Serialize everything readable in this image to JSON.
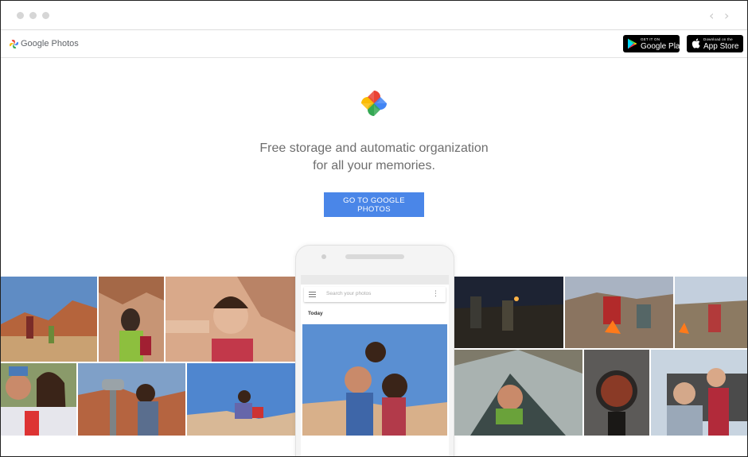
{
  "window": {
    "nav_back_icon": "‹",
    "nav_forward_icon": "›"
  },
  "header": {
    "brand": "Google Photos",
    "google_play": {
      "small": "GET IT ON",
      "big": "Google Play"
    },
    "app_store": {
      "small": "Download on the",
      "big": "App Store"
    }
  },
  "hero": {
    "tagline_line1": "Free storage and automatic organization",
    "tagline_line2": "for all your memories.",
    "cta_label": "GO TO GOOGLE PHOTOS"
  },
  "phone": {
    "search_placeholder": "Search your photos",
    "section_label": "Today",
    "kebab_icon": "⋮"
  },
  "colors": {
    "cta_blue": "#4a86e8",
    "pinwheel": [
      "#ea4335",
      "#fbbc05",
      "#34a853",
      "#4285f4"
    ]
  }
}
